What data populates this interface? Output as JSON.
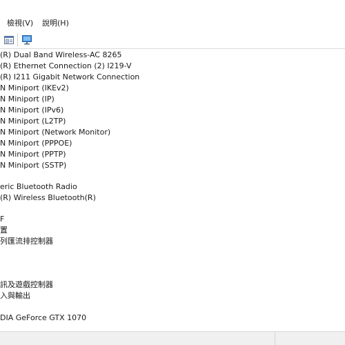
{
  "menu": {
    "view": "檢視(V)",
    "help": "說明(H)"
  },
  "toolbar": {
    "properties_icon": "properties-icon",
    "monitor_icon": "monitor-scan-icon"
  },
  "tree": {
    "rows": [
      "(R) Dual Band Wireless-AC 8265",
      "(R) Ethernet Connection (2) I219-V",
      "(R) I211 Gigabit Network Connection",
      "N Miniport (IKEv2)",
      "N Miniport (IP)",
      "N Miniport (IPv6)",
      "N Miniport (L2TP)",
      "N Miniport (Network Monitor)",
      "N Miniport (PPPOE)",
      "N Miniport (PPTP)",
      "N Miniport (SSTP)",
      "eric Bluetooth Radio",
      "(R) Wireless Bluetooth(R)",
      "F",
      "置",
      "列匯流排控制器",
      "訊及遊戲控制器",
      "入與輸出",
      "DIA GeForce GTX 1070"
    ]
  }
}
